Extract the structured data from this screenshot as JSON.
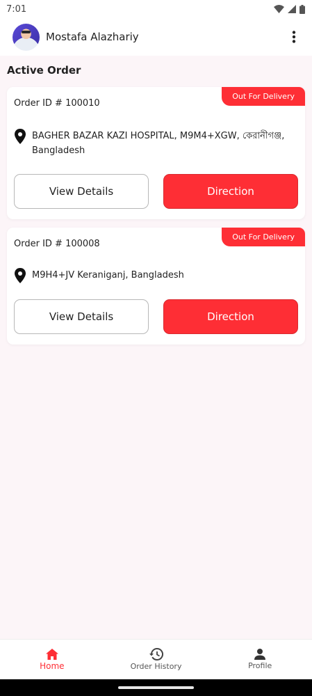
{
  "status_bar": {
    "time": "7:01"
  },
  "app_bar": {
    "user_name": "Mostafa Alazhariy"
  },
  "section_title": "Active Order",
  "orders": [
    {
      "status": "Out For Delivery",
      "order_id": "Order ID # 100010",
      "address": "BAGHER BAZAR KAZI HOSPITAL, M9M4+XGW, কেরানীগঞ্জ, Bangladesh",
      "view_details_label": "View Details",
      "direction_label": "Direction"
    },
    {
      "status": "Out For Delivery",
      "order_id": "Order ID # 100008",
      "address": "M9H4+JV Keraniganj, Bangladesh",
      "view_details_label": "View Details",
      "direction_label": "Direction"
    }
  ],
  "bottom_nav": {
    "items": [
      {
        "label": "Home",
        "icon": "home-icon",
        "active": true
      },
      {
        "label": "Order History",
        "icon": "history-icon",
        "active": false
      },
      {
        "label": "Profile",
        "icon": "person-icon",
        "active": false
      }
    ]
  },
  "colors": {
    "accent": "#fe2e35",
    "background": "#fcf5f8"
  }
}
